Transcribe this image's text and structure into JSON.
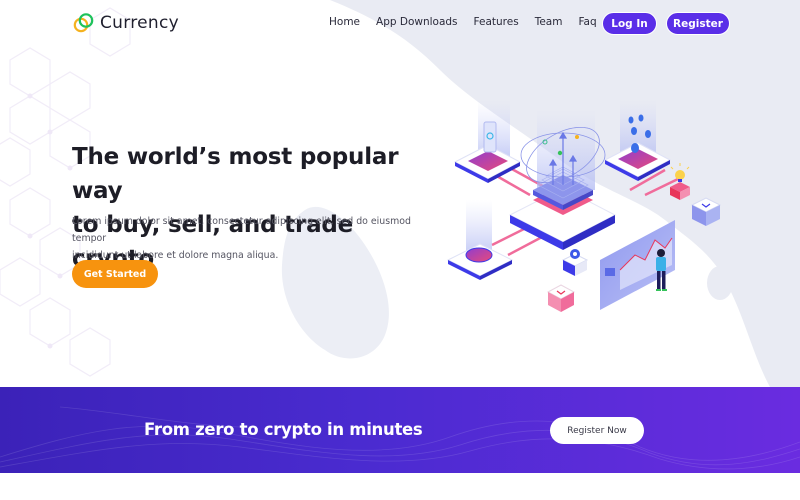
{
  "brand": {
    "name": "Currency",
    "logo_icon": "interlocked-rings-icon",
    "colors": {
      "ring_green": "#1ec25a",
      "ring_yellow": "#f5b21f"
    }
  },
  "nav": {
    "items": [
      {
        "label": "Home"
      },
      {
        "label": "App Downloads"
      },
      {
        "label": "Features"
      },
      {
        "label": "Team"
      },
      {
        "label": "Faq"
      }
    ],
    "login_label": "Log In",
    "register_label": "Register"
  },
  "hero": {
    "title_line1": "The world’s most popular way",
    "title_line2": "to buy, sell, and trade crypto",
    "description_line1": "Lorem ipsum dolor sit amet, consectetur adipiscing elit, sed do eiusmod tempor",
    "description_line2": "incididunt ut labore et dolore magna aliqua.",
    "cta_label": "Get Started",
    "illustration": "isometric-crypto-network-illustration"
  },
  "banner": {
    "title": "From zero to crypto in minutes",
    "cta_label": "Register Now"
  },
  "theme": {
    "primary": "#5a2ee8",
    "accent": "#f7930e",
    "banner_start": "#3b22b8",
    "banner_end": "#6a2ce0",
    "blob": "#e9ebf3"
  }
}
